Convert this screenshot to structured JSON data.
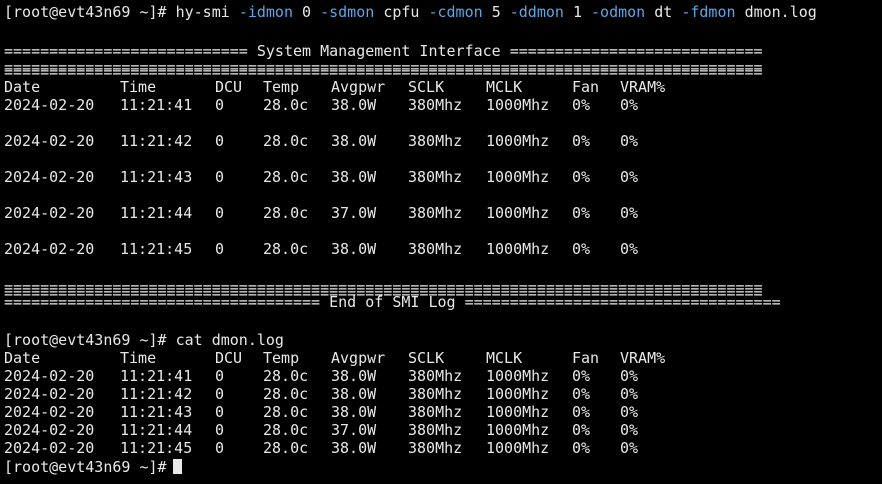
{
  "window": {
    "background": "#000000",
    "text_color": "#e8e8e8",
    "flag_color": "#5aa6e6"
  },
  "command1": {
    "prompt": "[root@evt43n69 ~]#",
    "parts": [
      {
        "text": "hy-smi",
        "kind": "plain"
      },
      {
        "text": "-idmon",
        "kind": "flag"
      },
      {
        "text": "0",
        "kind": "plain"
      },
      {
        "text": "-sdmon",
        "kind": "flag"
      },
      {
        "text": "cpfu",
        "kind": "plain"
      },
      {
        "text": "-cdmon",
        "kind": "flag"
      },
      {
        "text": "5",
        "kind": "plain"
      },
      {
        "text": "-ddmon",
        "kind": "flag"
      },
      {
        "text": "1",
        "kind": "plain"
      },
      {
        "text": "-odmon",
        "kind": "flag"
      },
      {
        "text": "dt",
        "kind": "plain"
      },
      {
        "text": "-fdmon",
        "kind": "flag"
      },
      {
        "text": "dmon.log",
        "kind": "plain"
      }
    ]
  },
  "smi": {
    "title_line": "=========================== System Management Interface ============================",
    "separator": "====================================================================================",
    "end_line": "=================================== End of SMI Log ===================================",
    "columns": [
      "Date",
      "Time",
      "DCU",
      "Temp",
      "Avgpwr",
      "SCLK",
      "MCLK",
      "Fan",
      "VRAM%"
    ],
    "rows": [
      [
        "2024-02-20",
        "11:21:41",
        "0",
        "28.0c",
        "38.0W",
        "380Mhz",
        "1000Mhz",
        "0%",
        "0%"
      ],
      [
        "2024-02-20",
        "11:21:42",
        "0",
        "28.0c",
        "38.0W",
        "380Mhz",
        "1000Mhz",
        "0%",
        "0%"
      ],
      [
        "2024-02-20",
        "11:21:43",
        "0",
        "28.0c",
        "38.0W",
        "380Mhz",
        "1000Mhz",
        "0%",
        "0%"
      ],
      [
        "2024-02-20",
        "11:21:44",
        "0",
        "28.0c",
        "37.0W",
        "380Mhz",
        "1000Mhz",
        "0%",
        "0%"
      ],
      [
        "2024-02-20",
        "11:21:45",
        "0",
        "28.0c",
        "38.0W",
        "380Mhz",
        "1000Mhz",
        "0%",
        "0%"
      ]
    ]
  },
  "command2": {
    "prompt": "[root@evt43n69 ~]#",
    "text": "cat dmon.log"
  },
  "log": {
    "columns": [
      "Date",
      "Time",
      "DCU",
      "Temp",
      "Avgpwr",
      "SCLK",
      "MCLK",
      "Fan",
      "VRAM%"
    ],
    "rows": [
      [
        "2024-02-20",
        "11:21:41",
        "0",
        "28.0c",
        "38.0W",
        "380Mhz",
        "1000Mhz",
        "0%",
        "0%"
      ],
      [
        "2024-02-20",
        "11:21:42",
        "0",
        "28.0c",
        "38.0W",
        "380Mhz",
        "1000Mhz",
        "0%",
        "0%"
      ],
      [
        "2024-02-20",
        "11:21:43",
        "0",
        "28.0c",
        "38.0W",
        "380Mhz",
        "1000Mhz",
        "0%",
        "0%"
      ],
      [
        "2024-02-20",
        "11:21:44",
        "0",
        "28.0c",
        "37.0W",
        "380Mhz",
        "1000Mhz",
        "0%",
        "0%"
      ],
      [
        "2024-02-20",
        "11:21:45",
        "0",
        "28.0c",
        "38.0W",
        "380Mhz",
        "1000Mhz",
        "0%",
        "0%"
      ]
    ]
  },
  "final_prompt": "[root@evt43n69 ~]#"
}
